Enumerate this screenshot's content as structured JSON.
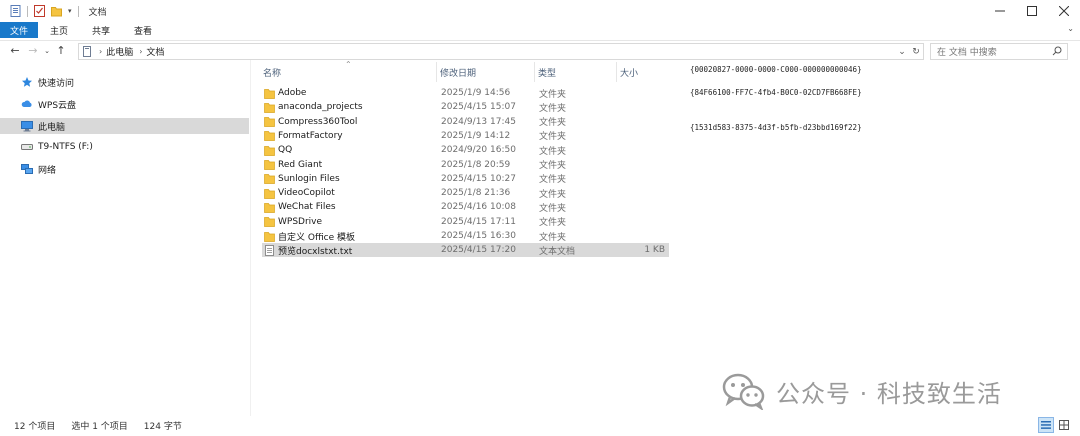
{
  "title": "文档",
  "ribbon": {
    "file": "文件",
    "tabs": [
      "主页",
      "共享",
      "查看"
    ]
  },
  "address": {
    "root": "此电脑",
    "folder": "文档"
  },
  "search": {
    "placeholder": "在 文档 中搜索"
  },
  "sidebar": {
    "items": [
      {
        "label": "快速访问",
        "icon": "star-icon"
      },
      {
        "label": "WPS云盘",
        "icon": "cloud-icon"
      },
      {
        "label": "此电脑",
        "icon": "computer-icon",
        "selected": true
      },
      {
        "label": "T9-NTFS (F:)",
        "icon": "drive-icon"
      },
      {
        "label": "网络",
        "icon": "network-icon"
      }
    ]
  },
  "columns": {
    "name": "名称",
    "date": "修改日期",
    "type": "类型",
    "size": "大小"
  },
  "files": [
    {
      "name": "Adobe",
      "date": "2025/1/9 14:56",
      "type": "文件夹",
      "size": "",
      "kind": "folder"
    },
    {
      "name": "anaconda_projects",
      "date": "2025/4/15 15:07",
      "type": "文件夹",
      "size": "",
      "kind": "folder"
    },
    {
      "name": "Compress360Tool",
      "date": "2024/9/13 17:45",
      "type": "文件夹",
      "size": "",
      "kind": "folder"
    },
    {
      "name": "FormatFactory",
      "date": "2025/1/9 14:12",
      "type": "文件夹",
      "size": "",
      "kind": "folder"
    },
    {
      "name": "QQ",
      "date": "2024/9/20 16:50",
      "type": "文件夹",
      "size": "",
      "kind": "folder"
    },
    {
      "name": "Red Giant",
      "date": "2025/1/8 20:59",
      "type": "文件夹",
      "size": "",
      "kind": "folder"
    },
    {
      "name": "Sunlogin Files",
      "date": "2025/4/15 10:27",
      "type": "文件夹",
      "size": "",
      "kind": "folder"
    },
    {
      "name": "VideoCopilot",
      "date": "2025/1/8 21:36",
      "type": "文件夹",
      "size": "",
      "kind": "folder"
    },
    {
      "name": "WeChat Files",
      "date": "2025/4/16 10:08",
      "type": "文件夹",
      "size": "",
      "kind": "folder"
    },
    {
      "name": "WPSDrive",
      "date": "2025/4/15 17:11",
      "type": "文件夹",
      "size": "",
      "kind": "folder"
    },
    {
      "name": "自定义 Office 模板",
      "date": "2025/4/15 16:30",
      "type": "文件夹",
      "size": "",
      "kind": "folder"
    },
    {
      "name": "预览docxlstxt.txt",
      "date": "2025/4/15 17:20",
      "type": "文本文档",
      "size": "1 KB",
      "kind": "text",
      "selected": true
    }
  ],
  "preview": {
    "lines": [
      "{00020827-0000-0000-C000-000000000046}",
      "{84F66100-FF7C-4fb4-B0C0-02CD7FB668FE}",
      "{1531d583-8375-4d3f-b5fb-d23bbd169f22}"
    ]
  },
  "watermark": {
    "text": "公众号 · 科技致生活"
  },
  "status": {
    "count": "12 个项目",
    "selected": "选中 1 个项目",
    "size": "124 字节"
  },
  "colors": {
    "accent": "#1979ca",
    "folder": "#f5c441",
    "selection": "#d9d9d9"
  }
}
